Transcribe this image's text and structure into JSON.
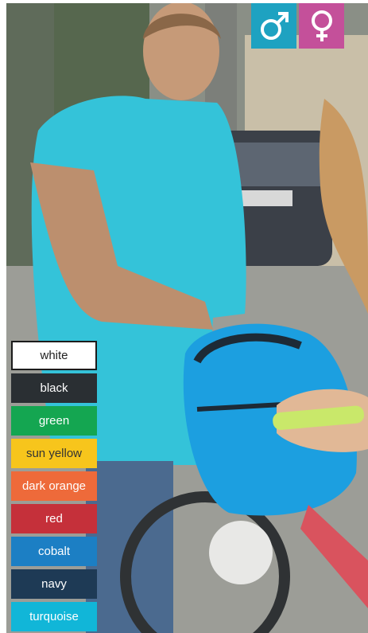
{
  "gender_filter": [
    {
      "icon": "male-symbol-icon",
      "color": "#1ea2c1"
    },
    {
      "icon": "female-symbol-icon",
      "color": "#c4509a"
    }
  ],
  "colors": [
    {
      "label": "white",
      "color": "#ffffff",
      "text_color": "#222222"
    },
    {
      "label": "black",
      "color": "#2a2f33",
      "text_color": "#ffffff"
    },
    {
      "label": "green",
      "color": "#14a651",
      "text_color": "#ffffff"
    },
    {
      "label": "sun yellow",
      "color": "#f7c51c",
      "text_color": "#333333"
    },
    {
      "label": "dark orange",
      "color": "#ee6a3a",
      "text_color": "#ffffff"
    },
    {
      "label": "red",
      "color": "#c5303a",
      "text_color": "#ffffff"
    },
    {
      "label": "cobalt",
      "color": "#1c7fc4",
      "text_color": "#ffffff"
    },
    {
      "label": "navy",
      "color": "#1e3a55",
      "text_color": "#ffffff"
    },
    {
      "label": "turquoise",
      "color": "#11b6d8",
      "text_color": "#ffffff"
    }
  ]
}
